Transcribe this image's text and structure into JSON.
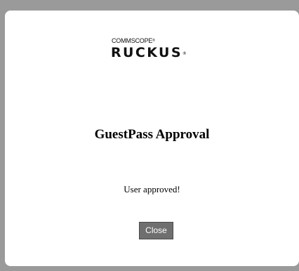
{
  "logo": {
    "brand_top": "COMMSCOPE",
    "brand_top_mark": "®",
    "brand_main": "RUCKUS",
    "brand_main_mark": "®"
  },
  "dialog": {
    "title": "GuestPass Approval",
    "message": "User approved!",
    "close_label": "Close"
  }
}
